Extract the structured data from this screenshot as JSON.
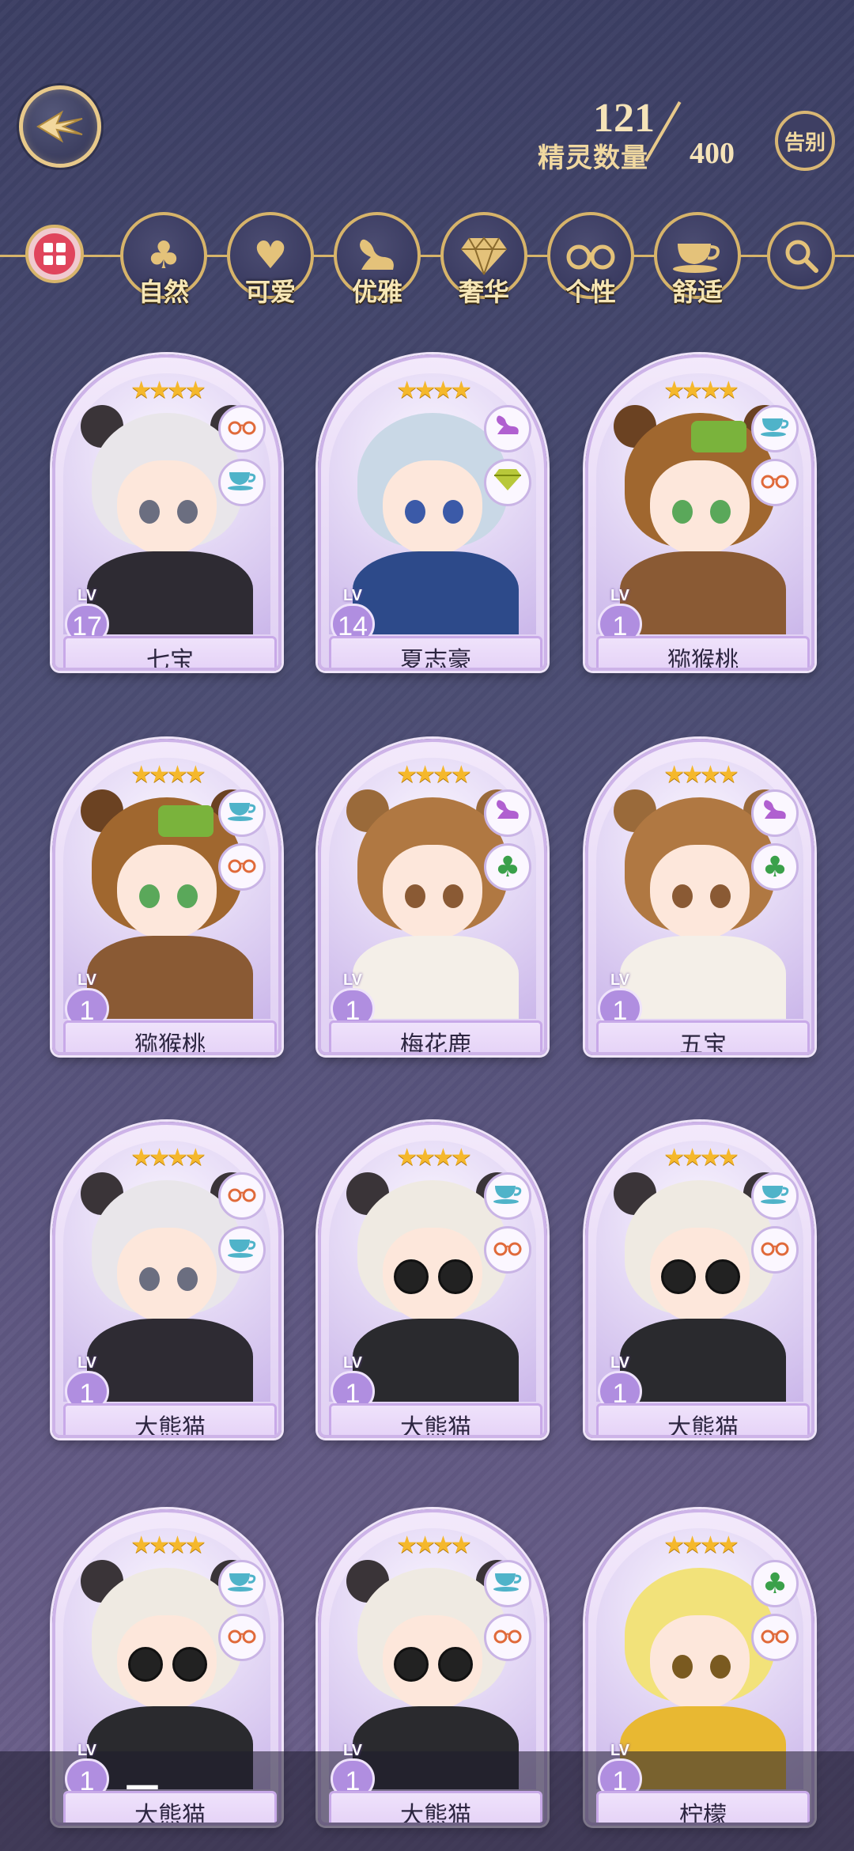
{
  "header": {
    "count": "121",
    "label": "精灵数量",
    "max": "400",
    "farewell_label": "告别"
  },
  "filters": [
    {
      "id": "all",
      "label": "",
      "icon": "grid-icon"
    },
    {
      "id": "nature",
      "label": "自然",
      "icon": "clover-icon"
    },
    {
      "id": "cute",
      "label": "可爱",
      "icon": "heart-icon"
    },
    {
      "id": "elegant",
      "label": "优雅",
      "icon": "swan-icon"
    },
    {
      "id": "luxury",
      "label": "奢华",
      "icon": "diamond-icon"
    },
    {
      "id": "personality",
      "label": "个性",
      "icon": "glasses-icon"
    },
    {
      "id": "comfort",
      "label": "舒适",
      "icon": "teacup-icon"
    },
    {
      "id": "search",
      "label": "",
      "icon": "search-icon"
    }
  ],
  "cards": [
    {
      "name": "七宝",
      "level": "17",
      "traits": [
        "glasses",
        "teacup"
      ],
      "style": "panda-boy"
    },
    {
      "name": "夏志豪",
      "level": "14",
      "traits": [
        "swan",
        "diamond"
      ],
      "style": "silver-boy"
    },
    {
      "name": "猕猴桃",
      "level": "1",
      "traits": [
        "teacup",
        "glasses"
      ],
      "style": "kiwi-girl"
    },
    {
      "name": "猕猴桃",
      "level": "1",
      "traits": [
        "teacup",
        "glasses"
      ],
      "style": "kiwi-girl"
    },
    {
      "name": "梅花鹿",
      "level": "1",
      "traits": [
        "swan",
        "clover"
      ],
      "style": "deer"
    },
    {
      "name": "五宝",
      "level": "1",
      "traits": [
        "swan",
        "clover"
      ],
      "style": "deer"
    },
    {
      "name": "大熊猫",
      "level": "1",
      "traits": [
        "glasses",
        "teacup"
      ],
      "style": "panda-boy"
    },
    {
      "name": "大熊猫",
      "level": "1",
      "traits": [
        "teacup",
        "glasses"
      ],
      "style": "panda-shades"
    },
    {
      "name": "大熊猫",
      "level": "1",
      "traits": [
        "teacup",
        "glasses"
      ],
      "style": "panda-shades"
    },
    {
      "name": "大熊猫",
      "level": "1",
      "traits": [
        "teacup",
        "glasses"
      ],
      "style": "panda-shades"
    },
    {
      "name": "大熊猫",
      "level": "1",
      "traits": [
        "teacup",
        "glasses"
      ],
      "style": "panda-shades"
    },
    {
      "name": "柠檬",
      "level": "1",
      "traits": [
        "clover",
        "glasses"
      ],
      "style": "lemon"
    }
  ],
  "card_common": {
    "stars": "★★★★",
    "lv_label": "LV"
  },
  "nav": {
    "menu_glyph": "☰",
    "home_glyph": "⌂",
    "back_glyph": "↩"
  },
  "colors": {
    "gold": "#d7b46a",
    "card_lilac": "#e0d0f3",
    "star": "#f5b82c"
  }
}
